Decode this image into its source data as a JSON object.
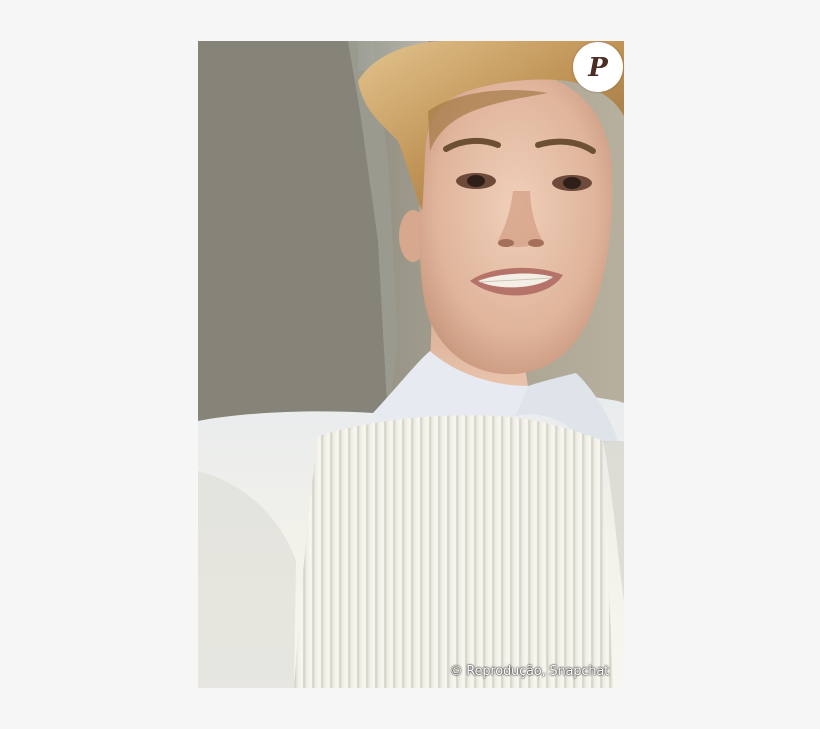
{
  "image": {
    "subject": "selfie-photo",
    "credit_text": "© Reprodução, Snapchat",
    "logo_letter": "P",
    "colors": {
      "page_background": "#f6f6f6",
      "wall": "#8f8d80",
      "skin": "#e6c3ad",
      "hair": "#c89c62",
      "shirt": "#f1f1ec",
      "logo_badge": "#ffffff",
      "logo_letter": "#4b2d24"
    }
  }
}
